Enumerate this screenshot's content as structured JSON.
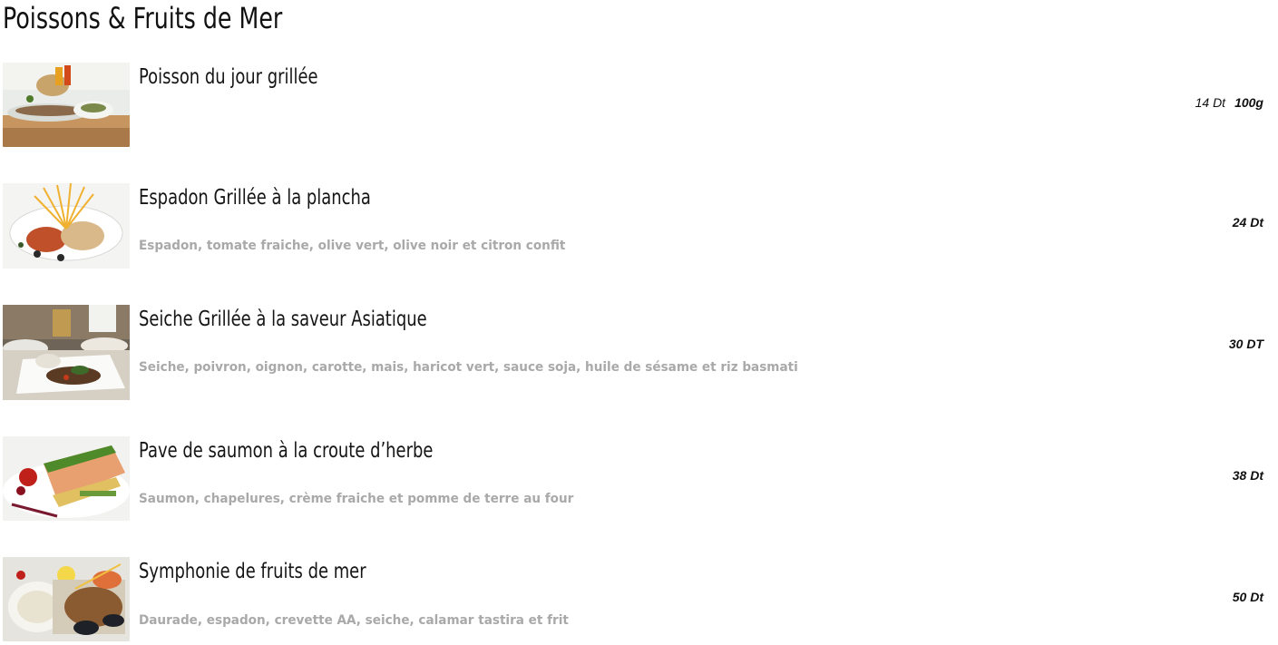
{
  "page": {
    "title": "Poissons & Fruits de Mer"
  },
  "items": [
    {
      "name": "Poisson du jour grillée",
      "description": "",
      "price": "14 Dt",
      "unit": "100g",
      "photo": "grilled-fish-photo"
    },
    {
      "name": "Espadon Grillée à la plancha",
      "description": "Espadon, tomate fraiche, olive vert,  olive noir et citron confit",
      "price": "24 Dt",
      "unit": "",
      "photo": "swordfish-photo"
    },
    {
      "name": "Seiche Grillée à la saveur Asiatique",
      "description": "Seiche, poivron, oignon, carotte, mais, haricot vert, sauce soja, huile de sésame et  riz basmati",
      "price": "30 DT",
      "unit": "",
      "photo": "cuttlefish-photo"
    },
    {
      "name": "Pave de saumon à la croute d’herbe",
      "description": "Saumon, chapelures, crème fraiche et pomme de terre au four",
      "price": "38 Dt",
      "unit": "",
      "photo": "salmon-photo"
    },
    {
      "name": "Symphonie de fruits de mer",
      "description": "Daurade, espadon, crevette AA, seiche, calamar tastira et frit",
      "price": "50 Dt",
      "unit": "",
      "photo": "seafood-platter-photo"
    }
  ]
}
